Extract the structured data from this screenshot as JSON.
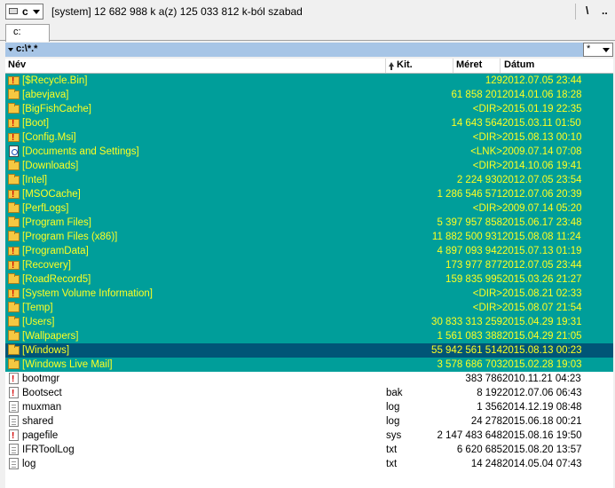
{
  "topbar": {
    "drive_letter": "c",
    "drive_info": "[system]  12 682 988 k a(z) 125 033 812 k-ból szabad",
    "root_button": "\\",
    "up_button": ".."
  },
  "tab": {
    "label": "c:"
  },
  "path": {
    "text": "c:\\*.*"
  },
  "filter": {
    "value": "*"
  },
  "columns": {
    "name": "Név",
    "ext": "Kit.",
    "size": "Méret",
    "date": "Dátum"
  },
  "rows": [
    {
      "type": "sysdir",
      "name": "[$Recycle.Bin]",
      "ext": "",
      "size": "129",
      "date": "2012.07.05 23:44"
    },
    {
      "type": "dir",
      "name": "[abevjava]",
      "ext": "",
      "size": "61 858 201",
      "date": "2014.01.06 18:28"
    },
    {
      "type": "dir",
      "name": "[BigFishCache]",
      "ext": "",
      "size": "<DIR>",
      "date": "2015.01.19 22:35"
    },
    {
      "type": "sysdir",
      "name": "[Boot]",
      "ext": "",
      "size": "14 643 564",
      "date": "2015.03.11 01:50"
    },
    {
      "type": "sysdir",
      "name": "[Config.Msi]",
      "ext": "",
      "size": "<DIR>",
      "date": "2015.08.13 00:10"
    },
    {
      "type": "link",
      "name": "[Documents and Settings]",
      "ext": "",
      "size": "<LNK>",
      "date": "2009.07.14 07:08"
    },
    {
      "type": "dir",
      "name": "[Downloads]",
      "ext": "",
      "size": "<DIR>",
      "date": "2014.10.06 19:41"
    },
    {
      "type": "dir",
      "name": "[Intel]",
      "ext": "",
      "size": "2 224 930",
      "date": "2012.07.05 23:54"
    },
    {
      "type": "sysdir",
      "name": "[MSOCache]",
      "ext": "",
      "size": "1 286 546 571",
      "date": "2012.07.06 20:39"
    },
    {
      "type": "dir",
      "name": "[PerfLogs]",
      "ext": "",
      "size": "<DIR>",
      "date": "2009.07.14 05:20"
    },
    {
      "type": "dir",
      "name": "[Program Files]",
      "ext": "",
      "size": "5 397 957 858",
      "date": "2015.06.17 23:48"
    },
    {
      "type": "dir",
      "name": "[Program Files (x86)]",
      "ext": "",
      "size": "11 882 500 931",
      "date": "2015.08.08 11:24"
    },
    {
      "type": "sysdir",
      "name": "[ProgramData]",
      "ext": "",
      "size": "4 897 093 942",
      "date": "2015.07.13 01:19"
    },
    {
      "type": "sysdir",
      "name": "[Recovery]",
      "ext": "",
      "size": "173 977 877",
      "date": "2012.07.05 23:44"
    },
    {
      "type": "dir",
      "name": "[RoadRecord5]",
      "ext": "",
      "size": "159 835 995",
      "date": "2015.03.26 21:27"
    },
    {
      "type": "sysdir",
      "name": "[System Volume Information]",
      "ext": "",
      "size": "<DIR>",
      "date": "2015.08.21 02:33"
    },
    {
      "type": "dir",
      "name": "[Temp]",
      "ext": "",
      "size": "<DIR>",
      "date": "2015.08.07 21:54"
    },
    {
      "type": "dir",
      "name": "[Users]",
      "ext": "",
      "size": "30 833 313 259",
      "date": "2015.04.29 19:31"
    },
    {
      "type": "dir",
      "name": "[Wallpapers]",
      "ext": "",
      "size": "1 561 083 388",
      "date": "2015.04.29 21:05"
    },
    {
      "type": "sel",
      "name": "[Windows]",
      "ext": "",
      "size": "55 942 561 514",
      "date": "2015.08.13 00:23"
    },
    {
      "type": "dir",
      "name": "[Windows Live Mail]",
      "ext": "",
      "size": "3 578 686 703",
      "date": "2015.02.28 19:03"
    },
    {
      "type": "sysfile",
      "name": "bootmgr",
      "ext": "",
      "size": "383 786",
      "date": "2010.11.21 04:23"
    },
    {
      "type": "sysfile",
      "name": "Bootsect",
      "ext": "bak",
      "size": "8 192",
      "date": "2012.07.06 06:43"
    },
    {
      "type": "file",
      "name": "muxman",
      "ext": "log",
      "size": "1 356",
      "date": "2014.12.19 08:48"
    },
    {
      "type": "file",
      "name": "shared",
      "ext": "log",
      "size": "24 278",
      "date": "2015.06.18 00:21"
    },
    {
      "type": "sysfile",
      "name": "pagefile",
      "ext": "sys",
      "size": "2 147 483 648",
      "date": "2015.08.16 19:50"
    },
    {
      "type": "file",
      "name": "IFRToolLog",
      "ext": "txt",
      "size": "6 620 685",
      "date": "2015.08.20 13:57"
    },
    {
      "type": "file",
      "name": "log",
      "ext": "txt",
      "size": "14 248",
      "date": "2014.05.04 07:43"
    }
  ]
}
